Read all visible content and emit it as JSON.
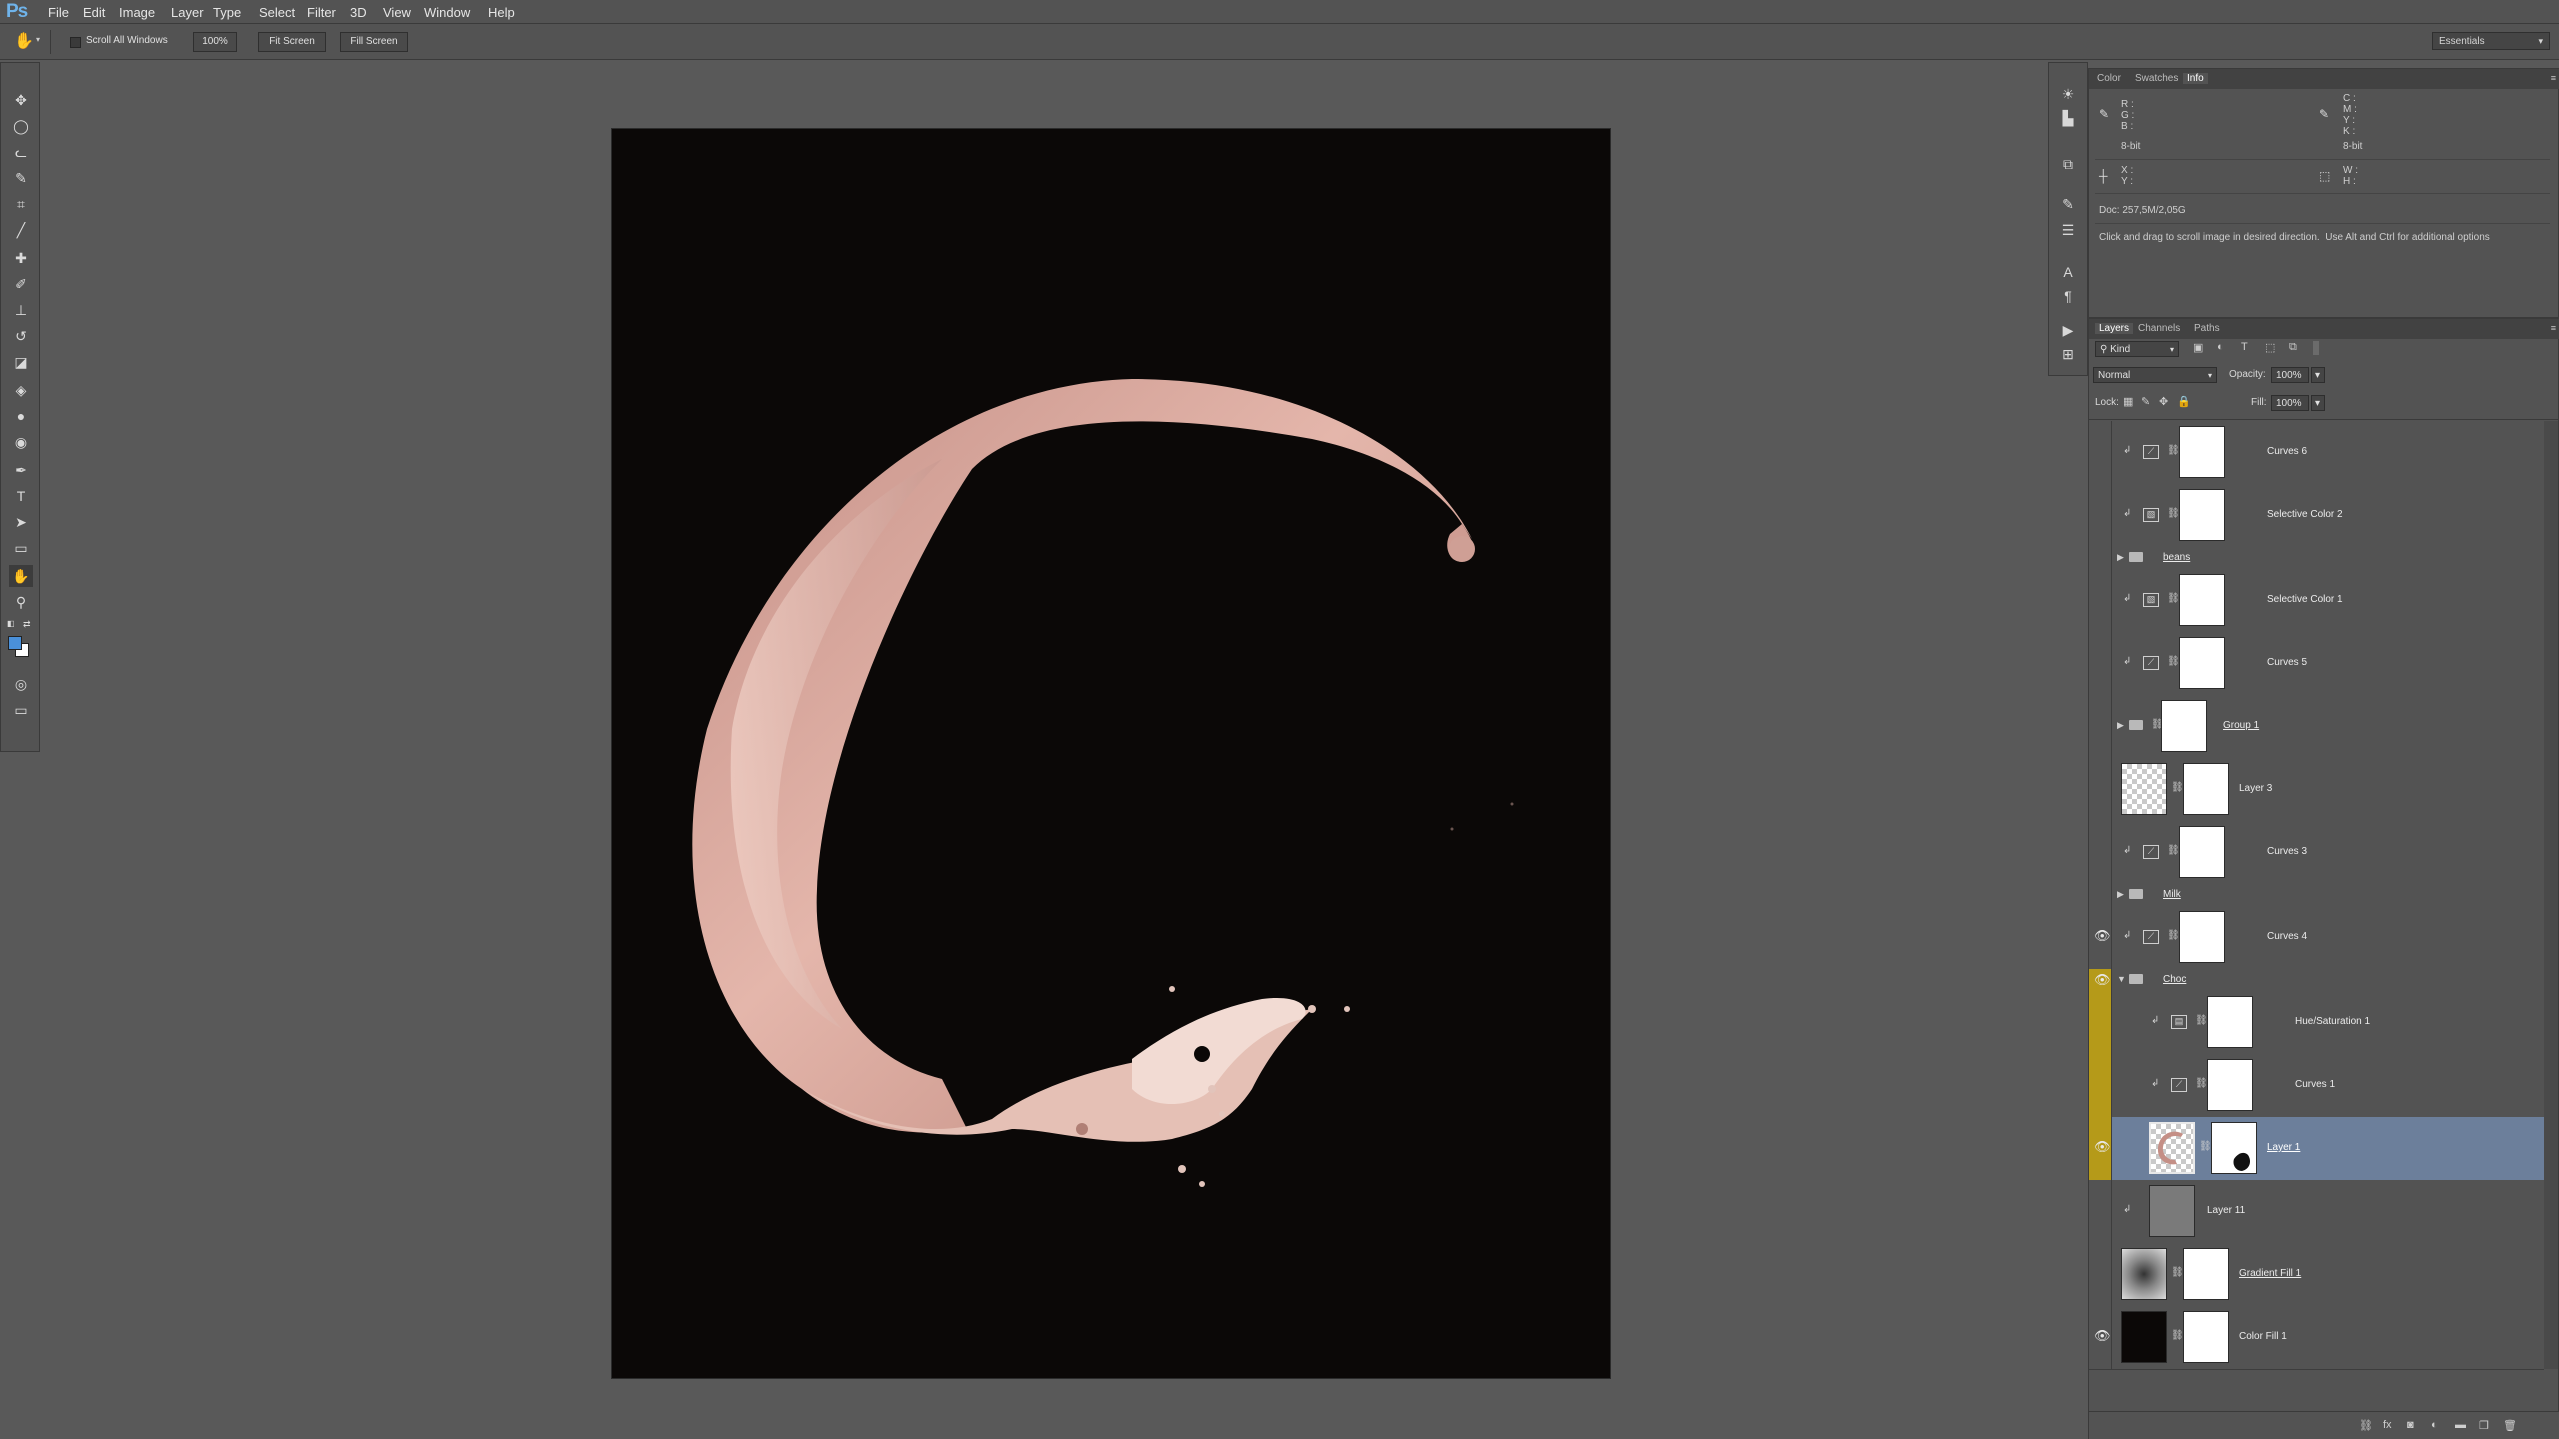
{
  "app": {
    "logo": "Ps"
  },
  "menu": [
    "File",
    "Edit",
    "Image",
    "Layer",
    "Type",
    "Select",
    "Filter",
    "3D",
    "View",
    "Window",
    "Help"
  ],
  "options": {
    "scroll_all_windows": "Scroll All Windows",
    "zoom_100": "100%",
    "fit_screen": "Fit Screen",
    "fill_screen": "Fill Screen",
    "workspace": "Essentials"
  },
  "info_panel": {
    "tabs": [
      "Color",
      "Swatches",
      "Info"
    ],
    "active_tab": "Info",
    "rgb": "R :\nG :\nB :",
    "bit_left": "8-bit",
    "cmyk": "C :\nM :\nY :\nK :",
    "bit_right": "8-bit",
    "xy": "X :\nY :",
    "wh": "W :\nH :",
    "doc": "Doc: 257,5M/2,05G",
    "hint": "Click and drag to scroll image in desired direction.  Use Alt and Ctrl for additional options"
  },
  "layers_panel": {
    "tabs": [
      "Layers",
      "Channels",
      "Paths"
    ],
    "active_tab": "Layers",
    "filter_kind": "Kind",
    "blend_mode": "Normal",
    "opacity_label": "Opacity:",
    "opacity": "100%",
    "lock_label": "Lock:",
    "fill_label": "Fill:",
    "fill": "100%",
    "layers": [
      {
        "name": "Curves 6",
        "kind": "adjustment",
        "icon": "curves",
        "visible": false
      },
      {
        "name": "Selective Color 2",
        "kind": "adjustment",
        "icon": "selective",
        "visible": false
      },
      {
        "name": "beans",
        "kind": "group",
        "expanded": false,
        "visible": false
      },
      {
        "name": "Selective Color 1",
        "kind": "adjustment",
        "icon": "selective",
        "visible": false
      },
      {
        "name": "Curves 5",
        "kind": "adjustment",
        "icon": "curves",
        "visible": false
      },
      {
        "name": "Group 1",
        "kind": "group-mask",
        "expanded": false,
        "visible": false
      },
      {
        "name": "Layer 3",
        "kind": "pixel-mask",
        "visible": false
      },
      {
        "name": "Curves 3",
        "kind": "adjustment",
        "icon": "curves",
        "visible": false
      },
      {
        "name": "Milk",
        "kind": "group",
        "expanded": false,
        "visible": false
      },
      {
        "name": "Curves 4",
        "kind": "adjustment",
        "icon": "curves",
        "visible": true
      },
      {
        "name": "Choc",
        "kind": "group",
        "expanded": true,
        "visible": true,
        "color": "yellow"
      },
      {
        "name": "Hue/Saturation 1",
        "kind": "adjustment-nested",
        "icon": "huesat",
        "visible": false,
        "color": "yellow"
      },
      {
        "name": "Curves 1",
        "kind": "adjustment-nested",
        "icon": "curves",
        "visible": false,
        "color": "yellow"
      },
      {
        "name": "Layer 1",
        "kind": "pixel-selected",
        "visible": true,
        "color": "yellow",
        "selected": true
      },
      {
        "name": "Layer 11",
        "kind": "pixel-gray",
        "visible": false
      },
      {
        "name": "Gradient Fill 1",
        "kind": "gradient",
        "visible": false
      },
      {
        "name": "Color Fill 1",
        "kind": "colorfill",
        "visible": true
      }
    ]
  },
  "colors": {
    "accent_blue": "#6fb3ea",
    "selected_layer": "#6c7f9b",
    "label_yellow": "#b59a19",
    "canvas_bg": "#0b0807",
    "splash": "#d9a79d"
  }
}
